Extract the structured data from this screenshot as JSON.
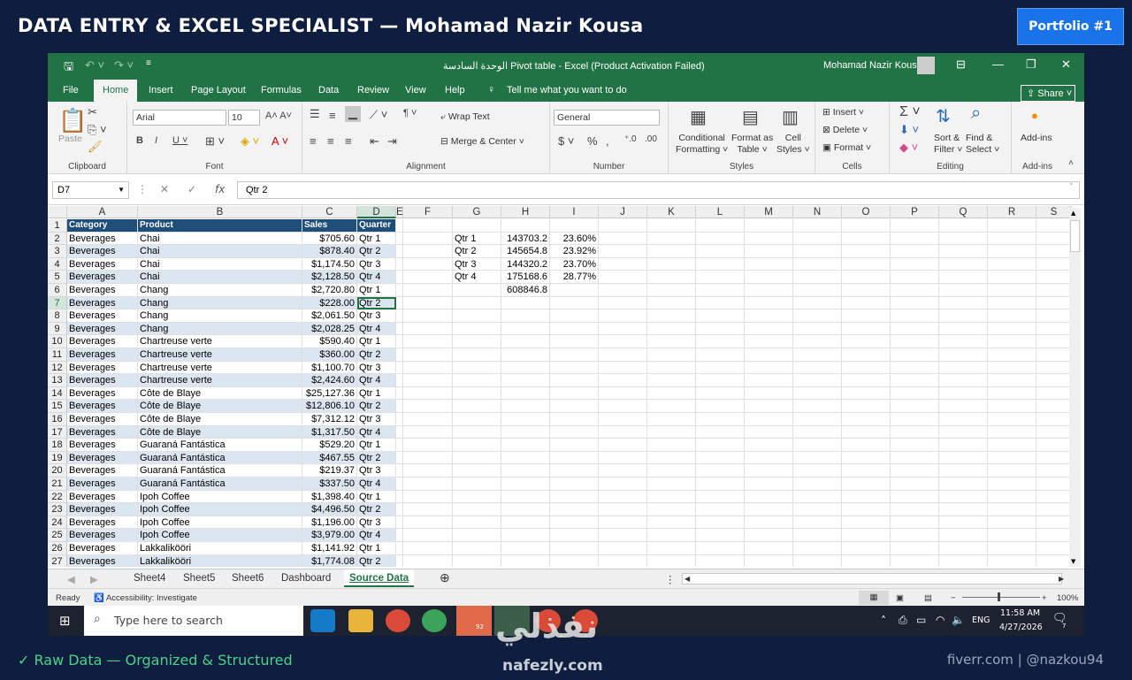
{
  "banner": {
    "title": " DATA ENTRY & EXCEL SPECIALIST — Mohamad Nazir Kousa",
    "badge": "Portfolio #1"
  },
  "footer": {
    "left": "✓ Raw Data — Organized & Structured",
    "right": "fiverr.com | @nazkou94",
    "watermark": "nafezly.com",
    "watermark_ar": "نفذلي"
  },
  "excel": {
    "title": "الوحدة السادسة Pivot table  -  Excel (Product Activation Failed)",
    "user": "Mohamad Nazir Kousa",
    "tabs": [
      "File",
      "Home",
      "Insert",
      "Page Layout",
      "Formulas",
      "Data",
      "Review",
      "View",
      "Help"
    ],
    "tell_me": "Tell me what you want to do",
    "share": "Share",
    "ribbon": {
      "clipboard": "Clipboard",
      "paste": "Paste",
      "font": "Font",
      "font_name": "Arial",
      "font_size": "10",
      "alignment": "Alignment",
      "wrap_text": "Wrap Text",
      "merge_center": "Merge & Center",
      "number": "Number",
      "number_format": "General",
      "styles": "Styles",
      "conditional_1": "Conditional",
      "conditional_2": "Formatting",
      "format_as_1": "Format as",
      "format_as_2": "Table",
      "cell_styles_1": "Cell",
      "cell_styles_2": "Styles",
      "cells": "Cells",
      "insert": "Insert",
      "delete": "Delete",
      "format": "Format",
      "editing": "Editing",
      "sort_1": "Sort &",
      "sort_2": "Filter",
      "find_1": "Find &",
      "find_2": "Select",
      "addins": "Add-ins",
      "addins_label": "Add-ins"
    },
    "name_box": "D7",
    "formula": "Qtr 2",
    "columns": [
      "A",
      "B",
      "C",
      "D",
      "E",
      "F",
      "G",
      "H",
      "I",
      "J",
      "K",
      "L",
      "M",
      "N",
      "O",
      "P",
      "Q",
      "R",
      "S"
    ],
    "headers": [
      "Category",
      "Product",
      "Sales",
      "Quarter"
    ],
    "rows": [
      [
        "Beverages",
        "Chai",
        "$705.60",
        "Qtr 1"
      ],
      [
        "Beverages",
        "Chai",
        "$878.40",
        "Qtr 2"
      ],
      [
        "Beverages",
        "Chai",
        "$1,174.50",
        "Qtr 3"
      ],
      [
        "Beverages",
        "Chai",
        "$2,128.50",
        "Qtr 4"
      ],
      [
        "Beverages",
        "Chang",
        "$2,720.80",
        "Qtr 1"
      ],
      [
        "Beverages",
        "Chang",
        "$228.00",
        "Qtr 2"
      ],
      [
        "Beverages",
        "Chang",
        "$2,061.50",
        "Qtr 3"
      ],
      [
        "Beverages",
        "Chang",
        "$2,028.25",
        "Qtr 4"
      ],
      [
        "Beverages",
        "Chartreuse verte",
        "$590.40",
        "Qtr 1"
      ],
      [
        "Beverages",
        "Chartreuse verte",
        "$360.00",
        "Qtr 2"
      ],
      [
        "Beverages",
        "Chartreuse verte",
        "$1,100.70",
        "Qtr 3"
      ],
      [
        "Beverages",
        "Chartreuse verte",
        "$2,424.60",
        "Qtr 4"
      ],
      [
        "Beverages",
        "Côte de Blaye",
        "$25,127.36",
        "Qtr 1"
      ],
      [
        "Beverages",
        "Côte de Blaye",
        "$12,806.10",
        "Qtr 2"
      ],
      [
        "Beverages",
        "Côte de Blaye",
        "$7,312.12",
        "Qtr 3"
      ],
      [
        "Beverages",
        "Côte de Blaye",
        "$1,317.50",
        "Qtr 4"
      ],
      [
        "Beverages",
        "Guaraná Fantástica",
        "$529.20",
        "Qtr 1"
      ],
      [
        "Beverages",
        "Guaraná Fantástica",
        "$467.55",
        "Qtr 2"
      ],
      [
        "Beverages",
        "Guaraná Fantástica",
        "$219.37",
        "Qtr 3"
      ],
      [
        "Beverages",
        "Guaraná Fantástica",
        "$337.50",
        "Qtr 4"
      ],
      [
        "Beverages",
        "Ipoh Coffee",
        "$1,398.40",
        "Qtr 1"
      ],
      [
        "Beverages",
        "Ipoh Coffee",
        "$4,496.50",
        "Qtr 2"
      ],
      [
        "Beverages",
        "Ipoh Coffee",
        "$1,196.00",
        "Qtr 3"
      ],
      [
        "Beverages",
        "Ipoh Coffee",
        "$3,979.00",
        "Qtr 4"
      ],
      [
        "Beverages",
        "Lakkalikööri",
        "$1,141.92",
        "Qtr 1"
      ],
      [
        "Beverages",
        "Lakkalikööri",
        "$1,774.08",
        "Qtr 2"
      ]
    ],
    "summary": [
      [
        "Qtr 1",
        "143703.2",
        "23.60%"
      ],
      [
        "Qtr 2",
        "145654.8",
        "23.92%"
      ],
      [
        "Qtr 3",
        "144320.2",
        "23.70%"
      ],
      [
        "Qtr 4",
        "175168.6",
        "28.77%"
      ],
      [
        "",
        "608846.8",
        ""
      ]
    ],
    "sheets": [
      "Sheet4",
      "Sheet5",
      "Sheet6",
      "Dashboard",
      "Source Data"
    ],
    "active_sheet": "Source Data",
    "status_ready": "Ready",
    "status_access": "Accessibility: Investigate",
    "zoom": "100%"
  },
  "taskbar": {
    "search": "Type here to search",
    "lang": "ENG",
    "time": "11:58 AM",
    "date": "4/27/2026",
    "telegram_badge": "92",
    "notif": "7"
  }
}
